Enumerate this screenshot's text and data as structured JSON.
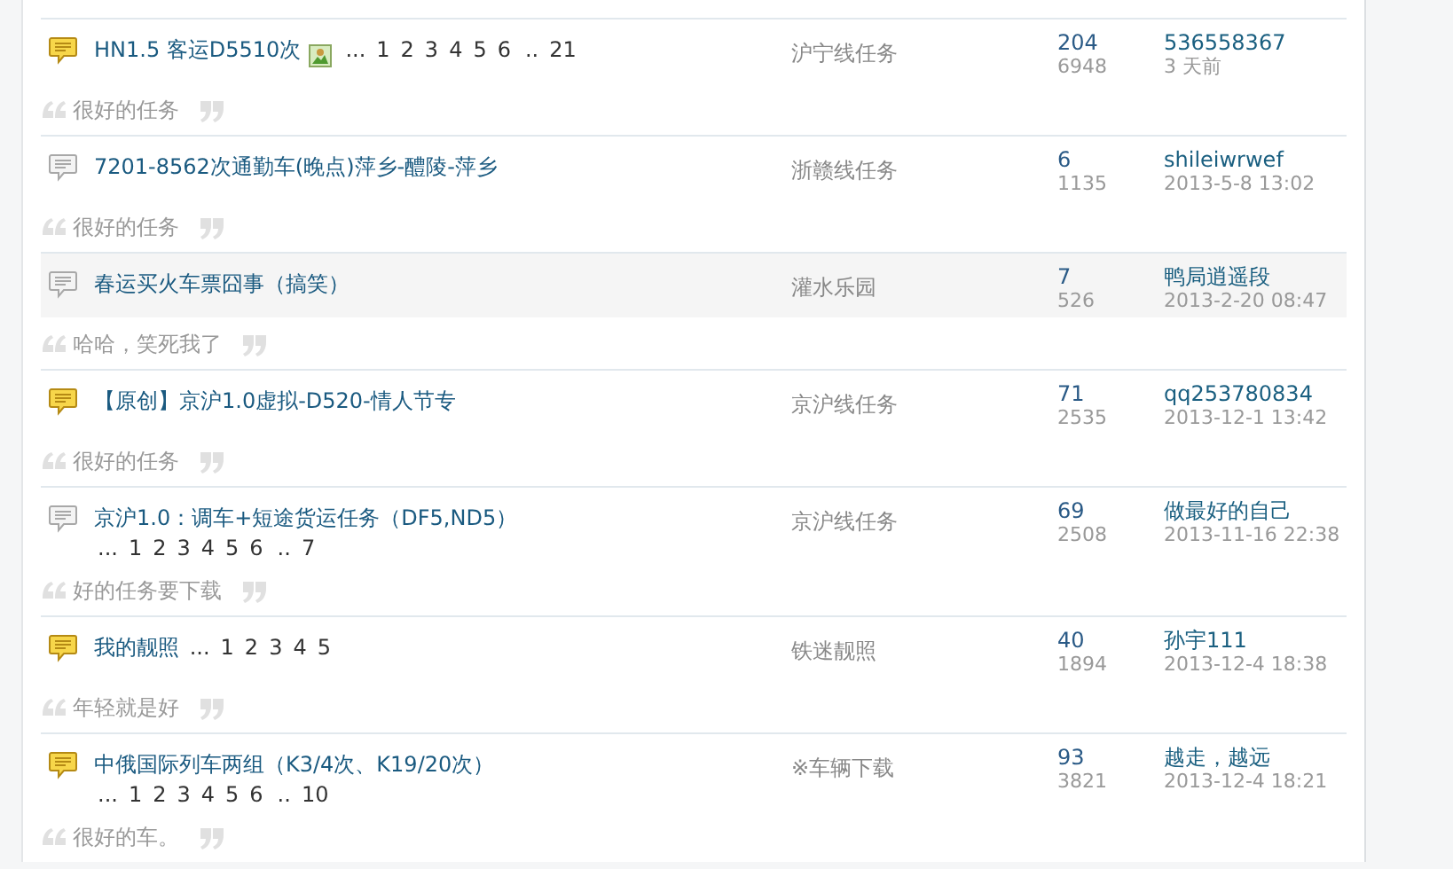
{
  "topics": [
    {
      "new": true,
      "title": "HN1.5 客运D5510次",
      "has_image": true,
      "pages": [
        {
          "kind": "gap",
          "text": "..."
        },
        {
          "kind": "page",
          "text": "1"
        },
        {
          "kind": "page",
          "text": "2"
        },
        {
          "kind": "page",
          "text": "3"
        },
        {
          "kind": "page",
          "text": "4"
        },
        {
          "kind": "page",
          "text": "5"
        },
        {
          "kind": "page",
          "text": "6"
        },
        {
          "kind": "gap",
          "text": ".."
        },
        {
          "kind": "page",
          "text": "21"
        }
      ],
      "forum": "沪宁线任务",
      "replies": "204",
      "views": "6948",
      "last_poster": "536558367",
      "last_time": "3 天前",
      "quote": "很好的任务"
    },
    {
      "new": false,
      "title": "7201-8562次通勤车(晚点)萍乡-醴陵-萍乡",
      "forum": "浙赣线任务",
      "replies": "6",
      "views": "1135",
      "last_poster": "shileiwrwef",
      "last_time": "2013-5-8 13:02",
      "quote": "很好的任务"
    },
    {
      "new": false,
      "title": "春运买火车票囧事（搞笑）",
      "forum": "灌水乐园",
      "replies": "7",
      "views": "526",
      "last_poster": "鸭局逍遥段",
      "last_time": "2013-2-20 08:47",
      "quote": "哈哈，笑死我了",
      "highlighted": true
    },
    {
      "new": true,
      "title": "【原创】京沪1.0虚拟-D520-情人节专",
      "forum": "京沪线任务",
      "replies": "71",
      "views": "2535",
      "last_poster": "qq253780834",
      "last_time": "2013-12-1 13:42",
      "quote": "很好的任务"
    },
    {
      "new": false,
      "title": "京沪1.0：调车+短途货运任务（DF5,ND5）",
      "pages": [
        {
          "kind": "gap",
          "text": "..."
        },
        {
          "kind": "page",
          "text": "1"
        },
        {
          "kind": "page",
          "text": "2"
        },
        {
          "kind": "page",
          "text": "3"
        },
        {
          "kind": "page",
          "text": "4"
        },
        {
          "kind": "page",
          "text": "5"
        },
        {
          "kind": "page",
          "text": "6"
        },
        {
          "kind": "gap",
          "text": ".."
        },
        {
          "kind": "page",
          "text": "7"
        }
      ],
      "forum": "京沪线任务",
      "replies": "69",
      "views": "2508",
      "last_poster": "做最好的自己",
      "last_time": "2013-11-16 22:38",
      "quote": "好的任务要下载"
    },
    {
      "new": true,
      "title": "我的靓照",
      "pages": [
        {
          "kind": "gap",
          "text": "..."
        },
        {
          "kind": "page",
          "text": "1"
        },
        {
          "kind": "page",
          "text": "2"
        },
        {
          "kind": "page",
          "text": "3"
        },
        {
          "kind": "page",
          "text": "4"
        },
        {
          "kind": "page",
          "text": "5"
        }
      ],
      "forum": "铁迷靓照",
      "replies": "40",
      "views": "1894",
      "last_poster": "孙宇111",
      "last_time": "2013-12-4 18:38",
      "quote": "年轻就是好"
    },
    {
      "new": true,
      "title": "中俄国际列车两组（K3/4次、K19/20次）",
      "pages": [
        {
          "kind": "gap",
          "text": "..."
        },
        {
          "kind": "page",
          "text": "1"
        },
        {
          "kind": "page",
          "text": "2"
        },
        {
          "kind": "page",
          "text": "3"
        },
        {
          "kind": "page",
          "text": "4"
        },
        {
          "kind": "page",
          "text": "5"
        },
        {
          "kind": "page",
          "text": "6"
        },
        {
          "kind": "gap",
          "text": ".."
        },
        {
          "kind": "page",
          "text": "10"
        }
      ],
      "forum": "※车辆下载",
      "replies": "93",
      "views": "3821",
      "last_poster": "越走，越远",
      "last_time": "2013-12-4 18:21",
      "quote": "很好的车。"
    }
  ]
}
